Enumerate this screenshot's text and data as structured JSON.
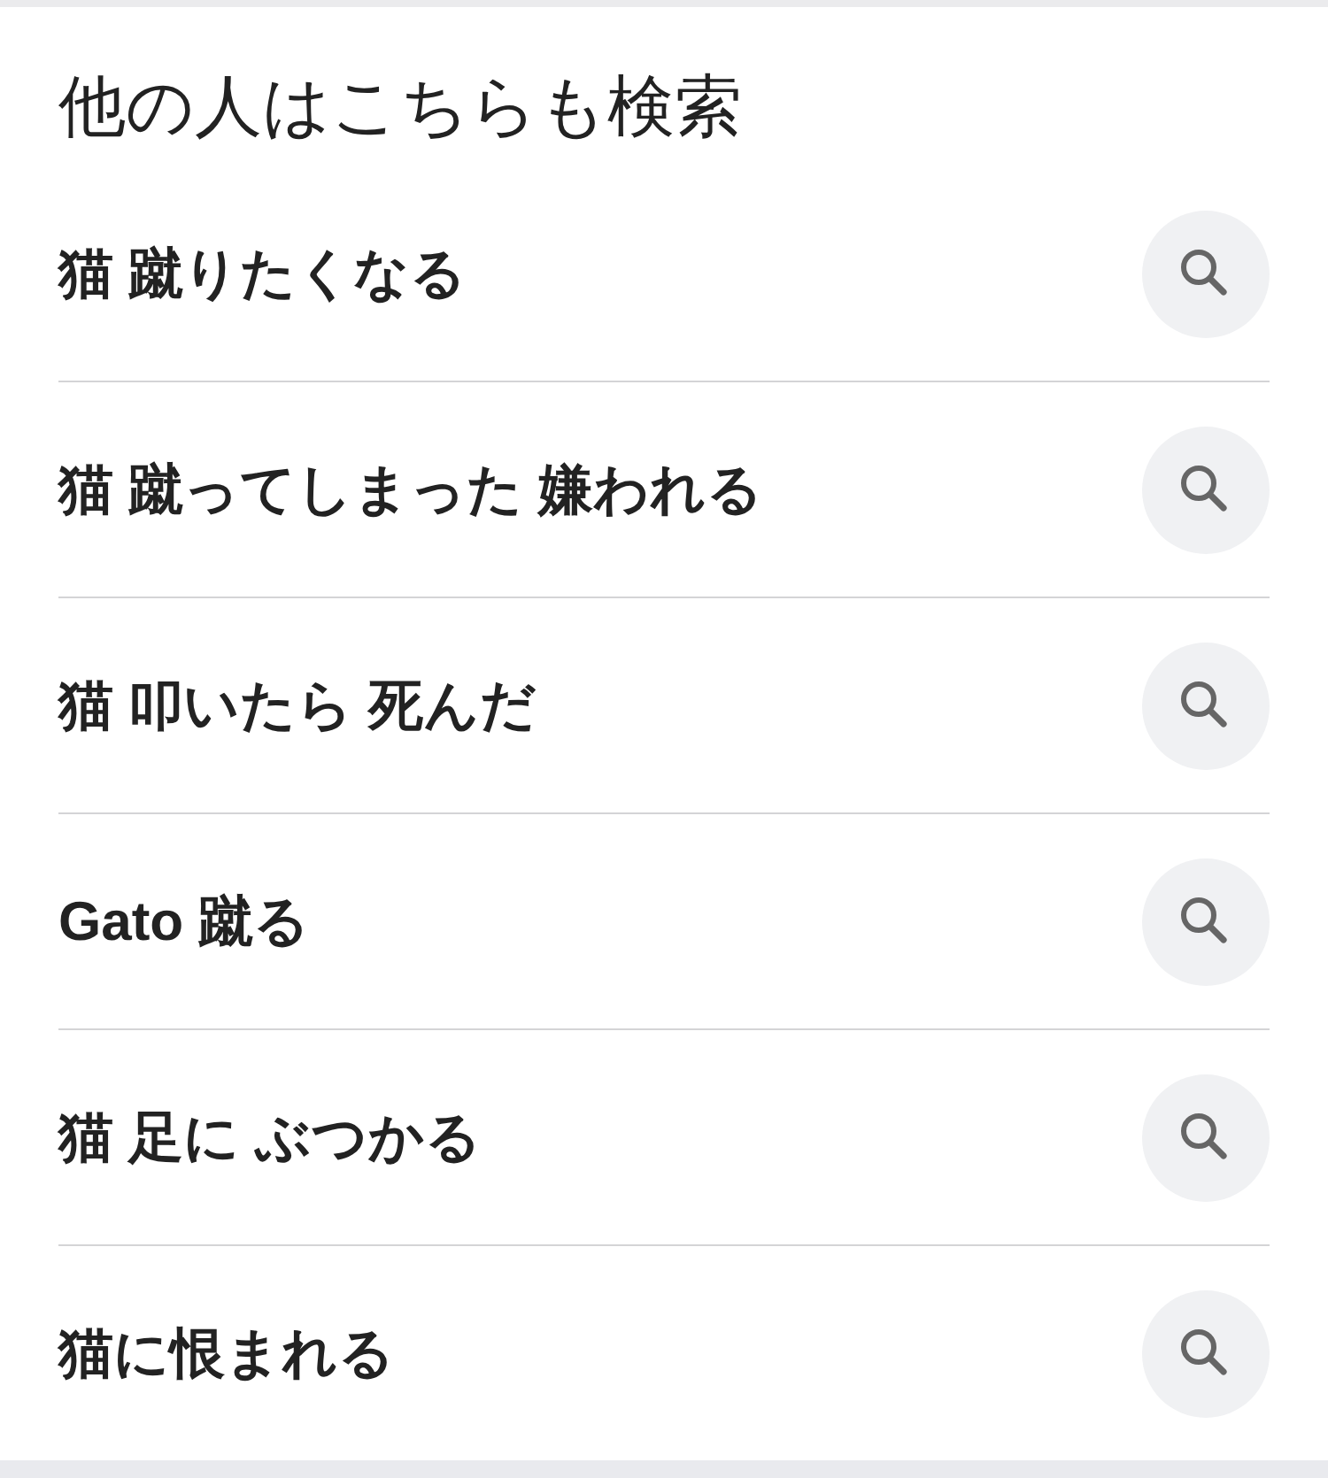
{
  "title": "他の人はこちらも検索",
  "items": [
    {
      "label": "猫 蹴りたくなる"
    },
    {
      "label": "猫 蹴ってしまった 嫌われる"
    },
    {
      "label": "猫 叩いたら 死んだ"
    },
    {
      "label": "Gato 蹴る"
    },
    {
      "label": "猫 足に ぶつかる"
    },
    {
      "label": "猫に恨まれる"
    }
  ]
}
